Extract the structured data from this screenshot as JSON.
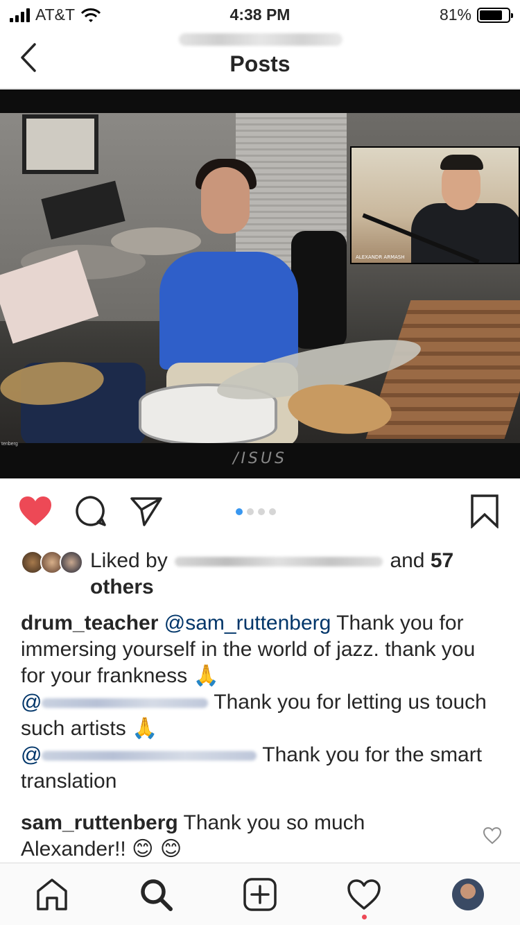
{
  "status_bar": {
    "carrier": "AT&T",
    "time": "4:38 PM",
    "battery_percent": "81%",
    "battery_level": 0.81
  },
  "header": {
    "title": "Posts"
  },
  "photo": {
    "pip_name": "ALEXANDR ARMASH",
    "monitor_brand": "/ISUS",
    "corner_label": "tenberg"
  },
  "actions": {
    "liked": true,
    "carousel_total": 4,
    "carousel_active": 1
  },
  "likes": {
    "prefix": "Liked by",
    "and_text": "and",
    "count": "57",
    "others": "others"
  },
  "caption": {
    "username": "drum_teacher",
    "mention": "@sam_ruttenberg",
    "text1": " Thank you for immersing yourself in the world of jazz. thank you for your frankness ",
    "emoji1": "🙏",
    "mention2_at": "@",
    "text2": "Thank you for letting us touch such artists ",
    "emoji2": "🙏",
    "mention3_at": "@",
    "text3": "Thank you for the smart translation"
  },
  "comment": {
    "username": "sam_ruttenberg",
    "text": " Thank you so much Alexander!! ",
    "emoji": "😊 😊"
  },
  "colors": {
    "like_red": "#ed4956",
    "active_dot": "#3897f0",
    "mention_blue": "#003569"
  },
  "tabbar": {
    "items": [
      "home-icon",
      "search-icon",
      "new-post-icon",
      "activity-icon",
      "profile-avatar"
    ]
  }
}
